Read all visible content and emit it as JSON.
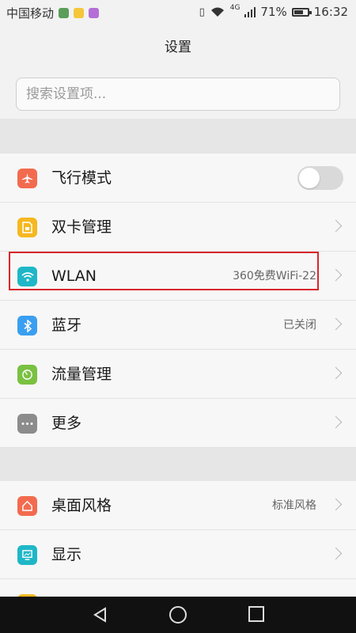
{
  "status_bar": {
    "carrier": "中国移动",
    "battery_pct": "71%",
    "battery_level": 0.71,
    "time": "16:32",
    "network": "4G"
  },
  "header": {
    "title": "设置"
  },
  "search": {
    "placeholder": "搜索设置项..."
  },
  "group1": [
    {
      "name": "airplane-mode",
      "label": "飞行模式",
      "icon": "airplane-icon",
      "color": "#f26b4f",
      "toggle": false
    },
    {
      "name": "dual-sim",
      "label": "双卡管理",
      "icon": "sim-card-icon",
      "color": "#f5b820"
    },
    {
      "name": "wlan",
      "label": "WLAN",
      "icon": "wifi-icon",
      "color": "#1fb7c7",
      "value": "360免费WiFi-22"
    },
    {
      "name": "bluetooth",
      "label": "蓝牙",
      "icon": "bluetooth-icon",
      "color": "#3a9ff0",
      "value": "已关闭"
    },
    {
      "name": "data-usage",
      "label": "流量管理",
      "icon": "gauge-icon",
      "color": "#7ac142"
    },
    {
      "name": "more",
      "label": "更多",
      "icon": "more-icon",
      "color": "#8c8c8c"
    }
  ],
  "group2": [
    {
      "name": "theme",
      "label": "桌面风格",
      "icon": "home-icon",
      "color": "#f26b4f",
      "value": "标准风格"
    },
    {
      "name": "display",
      "label": "显示",
      "icon": "display-icon",
      "color": "#1fb7c7"
    }
  ]
}
